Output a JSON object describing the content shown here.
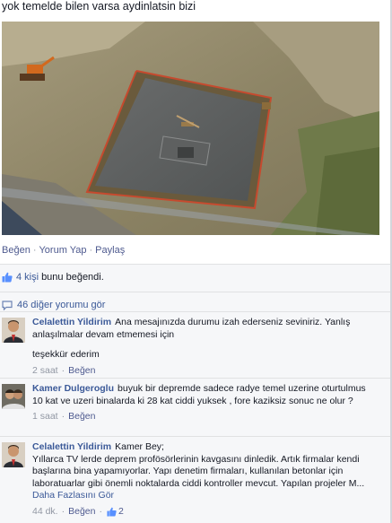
{
  "post": {
    "text": "yok temelde bilen varsa aydinlatsin bizi",
    "actions": {
      "like": "Beğen",
      "comment": "Yorum Yap",
      "share": "Paylaş"
    }
  },
  "likes": {
    "count": "4 kişi",
    "text": "bunu beğendi."
  },
  "more_comments": "46 diğer yorumu gör",
  "comments": [
    {
      "author": "Celalettin Yildirim",
      "text": "Ana mesajınızda durumu izah ederseniz seviniriz. Yanlış anlaşılmalar devam etmemesi için",
      "text2": "teşekkür ederim",
      "time": "2 saat",
      "like": "Beğen"
    },
    {
      "author": "Kamer Dulgeroglu",
      "text": "buyuk bir depremde sadece radye temel uzerine oturtulmus 10 kat ve uzeri binalarda ki 28 kat ciddi yuksek , fore kaziksiz sonuc ne olur ?",
      "time": "1 saat",
      "like": "Beğen"
    },
    {
      "author": "Celalettin Yildirim",
      "text": "Kamer Bey;",
      "text2": "Yıllarca TV lerde deprem profösörlerinin kavgasını dinledik. Artık firmalar kendi başlarına bina yapamıyorlar. Yapı denetim firmaları, kullanılan betonlar için laboratuarlar gibi önemli noktalarda ciddi kontroller mevcut. Yapılan projeler M...",
      "more": "Daha Fazlasını Gör",
      "time": "44 dk.",
      "like": "Beğen",
      "like_count": "2"
    }
  ],
  "colors": {
    "link": "#3b5998",
    "muted": "#9197a3",
    "panel": "#f6f7f9"
  }
}
